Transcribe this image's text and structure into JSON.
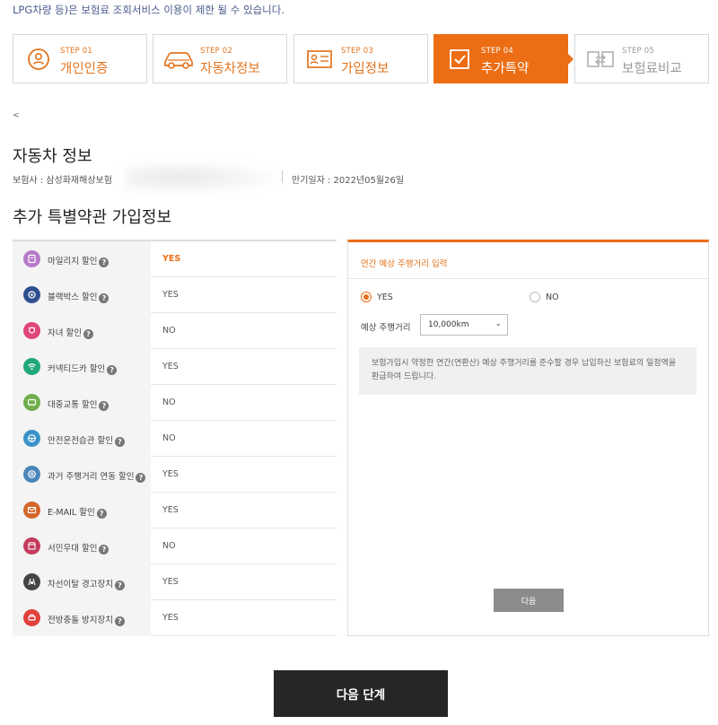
{
  "notice": "LPG차량 등)은 보험료 조회서비스 이용이 제한 될 수 있습니다.",
  "steps": [
    {
      "num": "STEP 01",
      "label": "개인인증",
      "icon": "person-icon"
    },
    {
      "num": "STEP 02",
      "label": "자동차정보",
      "icon": "car-icon"
    },
    {
      "num": "STEP 03",
      "label": "가입정보",
      "icon": "id-card-icon"
    },
    {
      "num": "STEP 04",
      "label": "추가특약",
      "icon": "checkbox-icon"
    },
    {
      "num": "STEP 05",
      "label": "보험료비교",
      "icon": "compare-icon"
    }
  ],
  "back": "<",
  "car_info": {
    "title": "자동차 정보",
    "insurer": "보험사 : 삼성화재해상보험",
    "expiry": "만기일자 : 2022년05월26일"
  },
  "extra": {
    "title": "추가 특별약관 가입정보",
    "help": "?",
    "rows": [
      {
        "name": "마일리지 할인",
        "value": "YES",
        "icon": "mileage-icon",
        "color": "#b67ac9"
      },
      {
        "name": "블랙박스 할인",
        "value": "YES",
        "icon": "blackbox-icon",
        "color": "#2f4f8f"
      },
      {
        "name": "자녀 할인",
        "value": "NO",
        "icon": "child-icon",
        "color": "#e0457b"
      },
      {
        "name": "커넥티드카 할인",
        "value": "YES",
        "icon": "wifi-icon",
        "color": "#21a77a"
      },
      {
        "name": "대중교통 할인",
        "value": "NO",
        "icon": "bus-icon",
        "color": "#6fae4a"
      },
      {
        "name": "안전운전습관 할인",
        "value": "NO",
        "icon": "steering-icon",
        "color": "#3a92c9"
      },
      {
        "name": "과거 주행거리 연동 할인",
        "value": "YES",
        "icon": "odometer-icon",
        "color": "#4a86b8"
      },
      {
        "name": "E-MAIL 할인",
        "value": "YES",
        "icon": "email-icon",
        "color": "#d5662a"
      },
      {
        "name": "서민우대 할인",
        "value": "NO",
        "icon": "shop-icon",
        "color": "#c43b5c"
      },
      {
        "name": "차선이탈 경고장치",
        "value": "YES",
        "icon": "lane-icon",
        "color": "#444444"
      },
      {
        "name": "전방충돌 방지장치",
        "value": "YES",
        "icon": "collision-icon",
        "color": "#e0413a"
      }
    ]
  },
  "panel": {
    "title": "연간 예상 주행거리 입력",
    "yes": "YES",
    "no": "NO",
    "distance_label": "예상 주행거리",
    "distance_value": "10,000km",
    "note": "보험가입시 약정한 연간(연환산) 예상 주행거리를 준수할 경우 납입하신 보험료의 일정액을 환급하여 드립니다.",
    "next": "다음"
  },
  "next_step": "다음 단계",
  "colors": {
    "accent": "#ec6d14",
    "dark_button": "#262626"
  }
}
